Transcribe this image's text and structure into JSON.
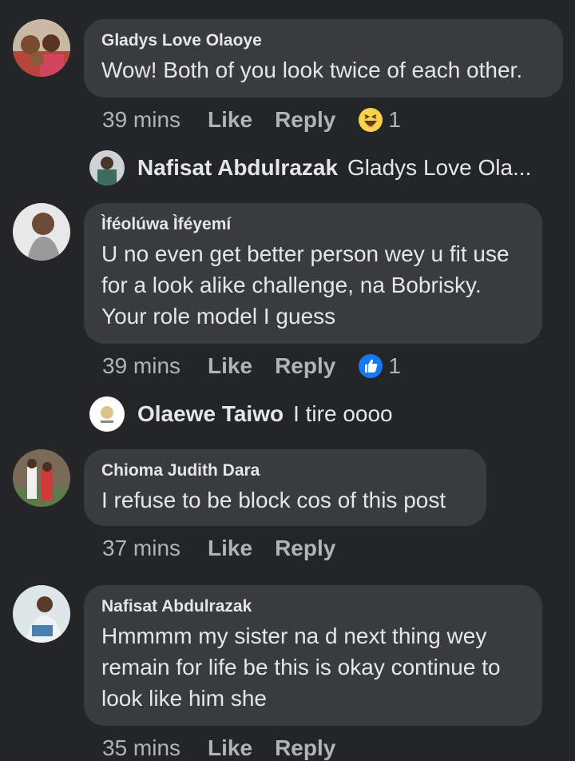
{
  "comments": [
    {
      "author": "Gladys Love Olaoye",
      "text_lines": [
        "Wow! Both of you look twice of each other."
      ],
      "time": "39 mins",
      "like_label": "Like",
      "reply_label": "Reply",
      "reaction": {
        "icon": "haha-emoji-icon",
        "count": "1"
      },
      "reply_preview": {
        "name": "Nafisat Abdulrazak",
        "text": "Gladys Love Ola..."
      }
    },
    {
      "author": "Ìféolúwa Ìféyemí",
      "text_lines": [
        "U no even get better person wey u fit use",
        "for a look alike challenge, na Bobrisky.",
        "Your role model I guess"
      ],
      "time": "39 mins",
      "like_label": "Like",
      "reply_label": "Reply",
      "reaction": {
        "icon": "like-thumb-icon",
        "count": "1"
      },
      "reply_preview": {
        "name": "Olaewe Taiwo",
        "text": "I tire oooo"
      }
    },
    {
      "author": "Chioma Judith Dara",
      "text_lines": [
        "I refuse to be block cos of this post"
      ],
      "time": "37 mins",
      "like_label": "Like",
      "reply_label": "Reply"
    },
    {
      "author": "Nafisat Abdulrazak",
      "text_lines": [
        "Hmmmm my sister na d next thing wey",
        "remain for life be this is okay continue to",
        "look like him she"
      ],
      "time": "35 mins",
      "like_label": "Like",
      "reply_label": "Reply"
    }
  ],
  "colors": {
    "background": "#242526",
    "bubble": "#3a3b3c",
    "text": "#e4e6eb",
    "muted": "#b0b3b8",
    "like_blue": "#1877f2",
    "haha_yellow": "#f7d24a"
  }
}
